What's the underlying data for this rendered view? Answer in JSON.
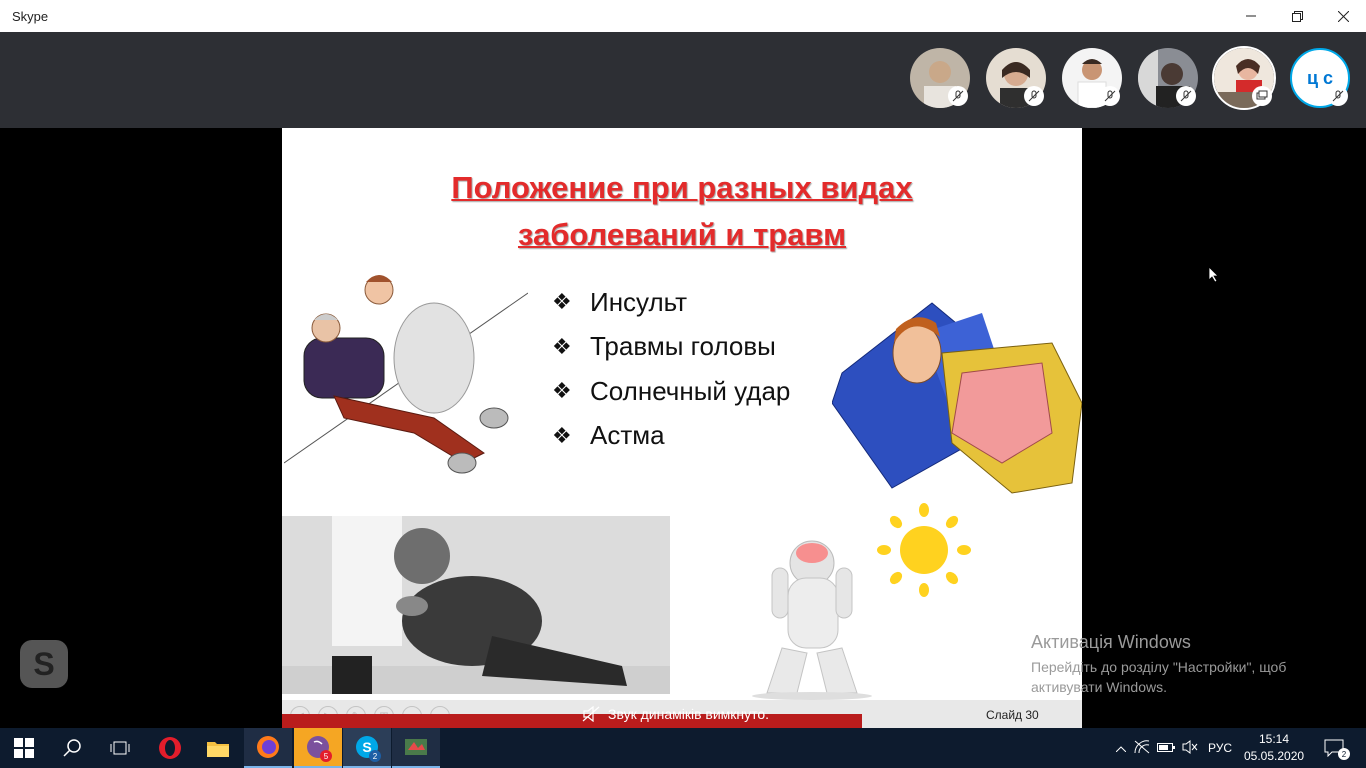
{
  "window": {
    "title": "Skype"
  },
  "participants": [
    {
      "kind": "photo",
      "tone": "#c9b59a"
    },
    {
      "kind": "photo",
      "tone": "#d9b9a0"
    },
    {
      "kind": "photo",
      "tone": "#e8d8c8"
    },
    {
      "kind": "photo",
      "tone": "#6b6f79"
    },
    {
      "kind": "photo",
      "tone": "#f0c7b4"
    },
    {
      "kind": "initials",
      "initials": "ц с"
    }
  ],
  "slide": {
    "title_line1": "Положение при разных видах",
    "title_line2": "заболеваний и травм",
    "bullets": [
      "Инсульт",
      "Травмы головы",
      "Солнечный удар",
      "Астма"
    ],
    "bullet_glyph": "❖",
    "slide_number": "Слайд 30"
  },
  "notification": {
    "text": "Звук динаміків вимкнуто."
  },
  "watermark": {
    "title": "Активація Windows",
    "subtitle": "Перейдіть до розділу \"Настройки\", щоб активувати Windows."
  },
  "taskbar": {
    "viber_badge": "5",
    "skype_badge": "2",
    "language": "РУС",
    "time": "15:14",
    "date": "05.05.2020",
    "notifications_badge": "2"
  },
  "colors": {
    "title_red": "#e32b2b",
    "callbar": "#2d2f34",
    "taskbar": "#0d1b2e",
    "skype_blue": "#00a8e8"
  }
}
